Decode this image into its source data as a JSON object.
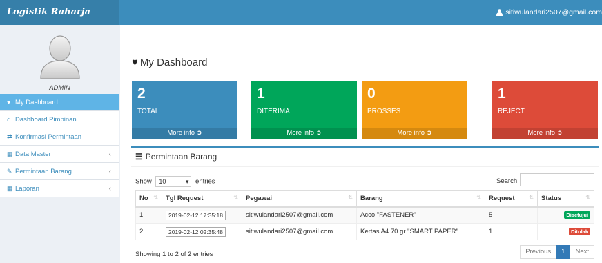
{
  "header": {
    "brand": "Logistik Raharja",
    "user_email": "sitiwulandari2507@gmail.com"
  },
  "sidebar": {
    "role": "ADMIN",
    "items": [
      {
        "label": "My Dashboard",
        "icon": "heart-icon"
      },
      {
        "label": "Dashboard Pimpinan",
        "icon": "home-icon"
      },
      {
        "label": "Konfirmasi Permintaan",
        "icon": "exchange-icon"
      },
      {
        "label": "Data Master",
        "icon": "grid-icon"
      },
      {
        "label": "Permintaan Barang",
        "icon": "edit-icon"
      },
      {
        "label": "Laporan",
        "icon": "grid-icon"
      }
    ]
  },
  "page": {
    "title": "My Dashboard"
  },
  "stats": [
    {
      "value": "2",
      "label": "TOTAL",
      "more": "More info",
      "color": "#3c8dbc"
    },
    {
      "value": "1",
      "label": "DITERIMA",
      "more": "More info",
      "color": "#00a65a"
    },
    {
      "value": "0",
      "label": "PROSSES",
      "more": "More info",
      "color": "#f39c12"
    },
    {
      "value": "1",
      "label": "REJECT",
      "more": "More info",
      "color": "#dd4b39"
    }
  ],
  "panel": {
    "title": "Permintaan Barang",
    "show_label": "Show",
    "entries_value": "10",
    "entries_label": "entries",
    "search_label": "Search:",
    "columns": [
      "No",
      "Tgl Request",
      "Pegawai",
      "Barang",
      "Request",
      "Status"
    ],
    "rows": [
      {
        "no": "1",
        "tgl": "2019-02-12 17:35:18",
        "pegawai": "sitiwulandari2507@gmail.com",
        "barang": "Acco \"FASTENER\"",
        "request": "5",
        "status": "Disetujui",
        "status_color": "#00a65a"
      },
      {
        "no": "2",
        "tgl": "2019-02-12 02:35:48",
        "pegawai": "sitiwulandari2507@gmail.com",
        "barang": "Kertas A4 70 gr \"SMART PAPER\"",
        "request": "1",
        "status": "Ditolak",
        "status_color": "#dd4b39"
      }
    ],
    "info": "Showing 1 to 2 of 2 entries",
    "pagination": {
      "previous": "Previous",
      "current": "1",
      "next": "Next"
    }
  }
}
